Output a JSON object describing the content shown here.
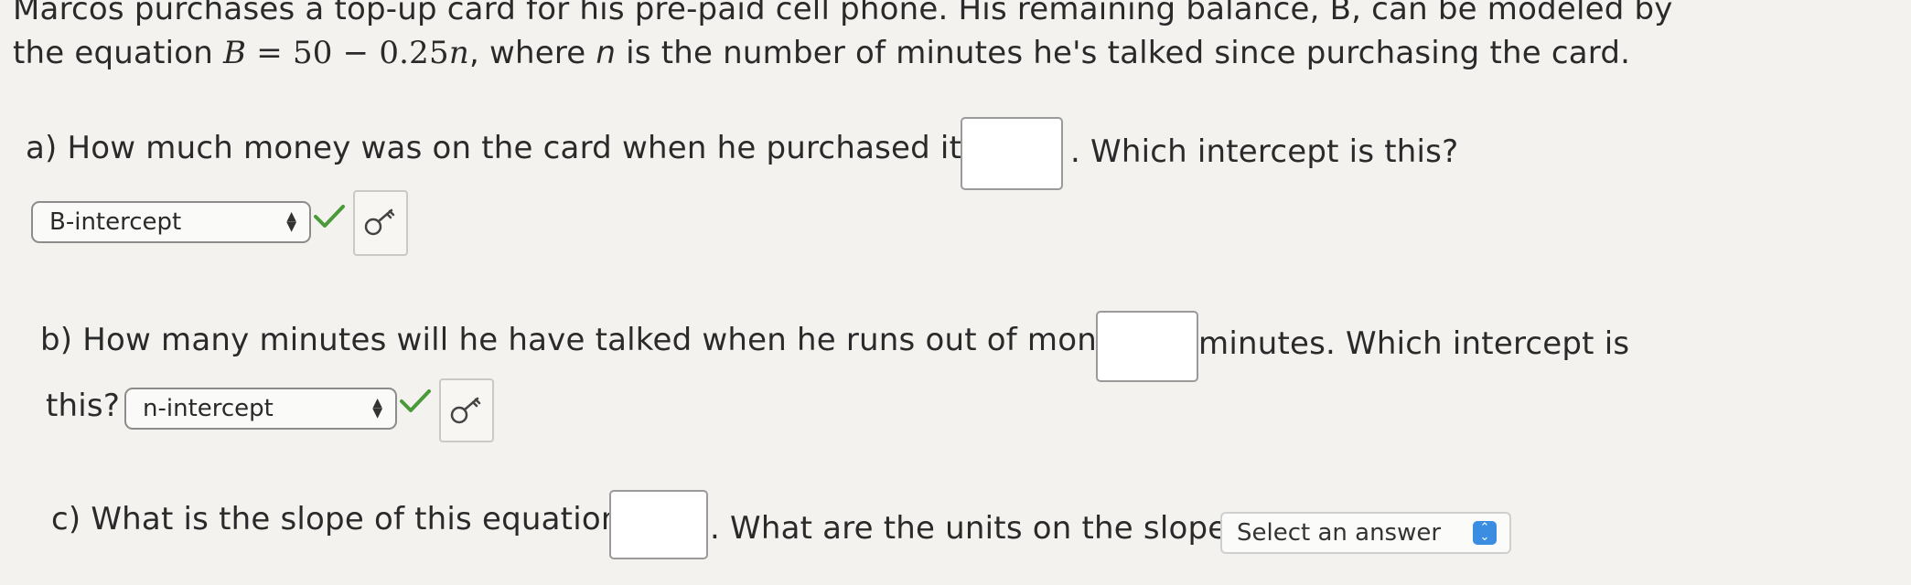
{
  "intro": {
    "line1": "Marcos purchases a top-up card for his pre-paid cell phone. His remaining balance, B, can be modeled by",
    "line2_before": "the equation ",
    "equation": {
      "B": "B",
      "equals": " = ",
      "fifty": "50",
      "minus": " − ",
      "coef": "0.25",
      "n": "n"
    },
    "line2_after_comma": ", where ",
    "n_var": "n",
    "line2_rest": " is the number of minutes he's talked since purchasing the card."
  },
  "part_a": {
    "question": "a) How much money was on the card when he purchased it? $",
    "answer_value": "",
    "question_after": ". Which intercept is this?",
    "select_value": "B-intercept"
  },
  "part_b": {
    "question": "b) How many minutes will he have talked when he runs out of money?",
    "answer_value": "",
    "question_after": "minutes. Which intercept is",
    "question_line2": "this?",
    "select_value": "n-intercept"
  },
  "part_c": {
    "question": "c) What is the slope of this equation?",
    "answer_value": "",
    "question_after": ". What are the units on the slope?",
    "select_placeholder": "Select an answer"
  },
  "colors": {
    "check_green": "#4a9a3a",
    "dropdown_blue": "#3a8de0"
  }
}
